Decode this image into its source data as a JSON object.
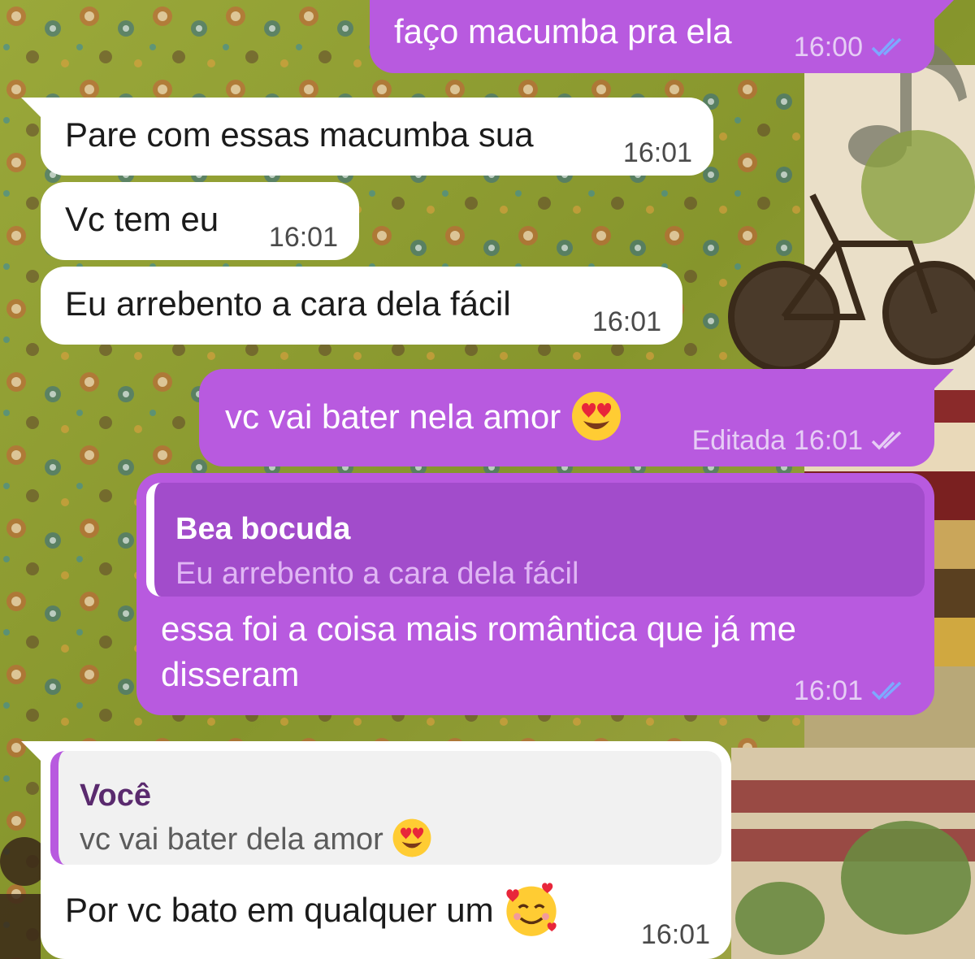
{
  "colors": {
    "outgoing_bubble": "#b85adf",
    "incoming_bubble": "#ffffff",
    "read_ticks": "#7ea8ff",
    "edited_ticks": "#e6cdf5"
  },
  "messages": [
    {
      "direction": "out",
      "text": "faço macumba pra ela",
      "time": "16:00",
      "status_icon": "double-check-icon"
    },
    {
      "direction": "in",
      "text": "Pare com essas macumba sua",
      "time": "16:01"
    },
    {
      "direction": "in",
      "text": "Vc tem eu",
      "time": "16:01"
    },
    {
      "direction": "in",
      "text": "Eu arrebento a cara dela fácil",
      "time": "16:01"
    },
    {
      "direction": "out",
      "text": "vc vai bater nela amor",
      "emoji": "heart-eyes-emoji",
      "edited_label": "Editada",
      "time": "16:01",
      "status_icon": "double-check-icon"
    },
    {
      "direction": "out",
      "reply": {
        "author": "Bea bocuda",
        "text": "Eu arrebento a cara dela fácil"
      },
      "text_line1": "essa foi a coisa mais romântica que já me",
      "text_line2": "disseram",
      "time": "16:01",
      "status_icon": "double-check-icon"
    },
    {
      "direction": "in",
      "reply": {
        "author": "Você",
        "text": "vc vai bater dela amor",
        "emoji": "heart-eyes-emoji"
      },
      "text": "Por vc bato em qualquer um",
      "emoji": "smiling-face-with-hearts-emoji",
      "time": "16:01"
    }
  ]
}
